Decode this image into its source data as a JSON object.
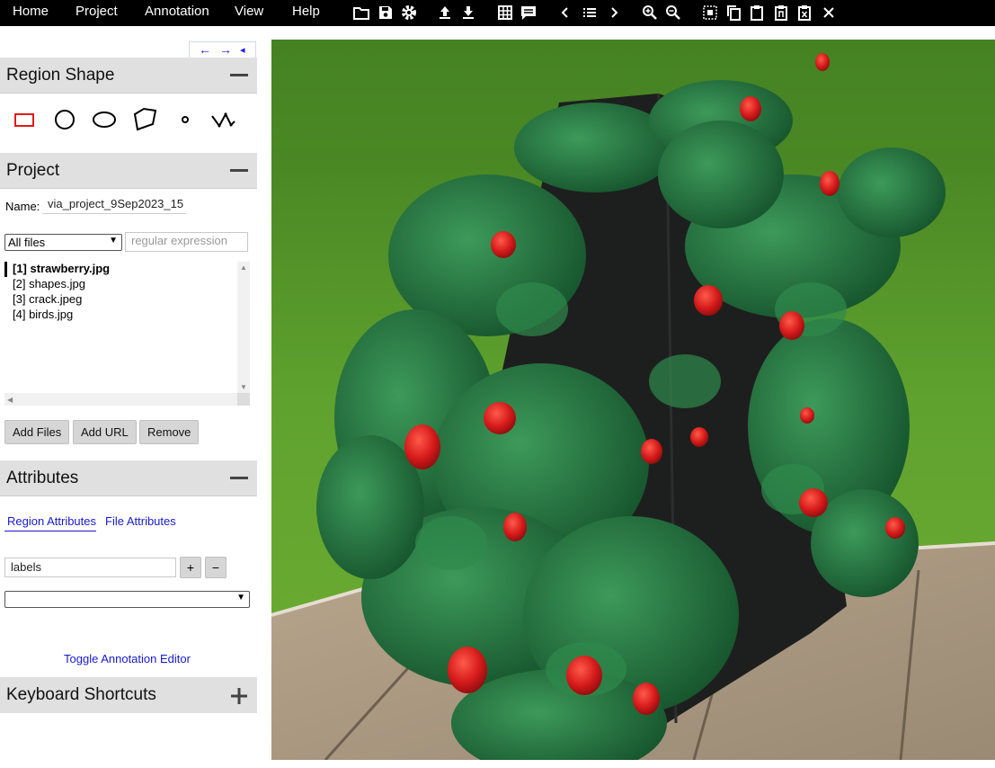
{
  "menu": {
    "items": [
      "Home",
      "Project",
      "Annotation",
      "View",
      "Help"
    ]
  },
  "toolbar": {
    "icons": [
      "folder-icon",
      "save-icon",
      "gear-icon",
      "upload-icon",
      "download-icon",
      "grid-icon",
      "comment-icon",
      "chevron-left-icon",
      "list-icon",
      "chevron-right-icon",
      "zoom-in-icon",
      "zoom-out-icon",
      "select-all-icon",
      "copy-icon",
      "paste-icon",
      "paste-n-icon",
      "paste-delete-icon",
      "close-icon"
    ]
  },
  "nav": {
    "prev": "←",
    "next": "→",
    "collapse": "◂"
  },
  "region_shape": {
    "title": "Region Shape",
    "toggle": "—",
    "shapes": [
      "rectangle",
      "circle",
      "ellipse",
      "polygon",
      "point",
      "polyline"
    ],
    "active_shape": "rectangle",
    "active_color": "#e0191a"
  },
  "project": {
    "title": "Project",
    "toggle": "—",
    "name_label": "Name:",
    "name_value": "via_project_9Sep2023_15",
    "filter_select": "All files",
    "filter_placeholder": "regular expression",
    "files": [
      {
        "label": "[1] strawberry.jpg",
        "active": true
      },
      {
        "label": "[2] shapes.jpg",
        "active": false
      },
      {
        "label": "[3] crack.jpeg",
        "active": false
      },
      {
        "label": "[4] birds.jpg",
        "active": false
      }
    ],
    "buttons": {
      "add_files": "Add Files",
      "add_url": "Add URL",
      "remove": "Remove"
    }
  },
  "attributes": {
    "title": "Attributes",
    "toggle": "—",
    "tabs": {
      "region": "Region Attributes",
      "file": "File Attributes"
    },
    "attr_name": "labels",
    "add": "+",
    "remove": "−",
    "select_value": "",
    "toggle_editor": "Toggle Annotation Editor"
  },
  "shortcuts": {
    "title": "Keyboard Shortcuts",
    "toggle": "+"
  },
  "canvas": {
    "image": "strawberry.jpg"
  }
}
